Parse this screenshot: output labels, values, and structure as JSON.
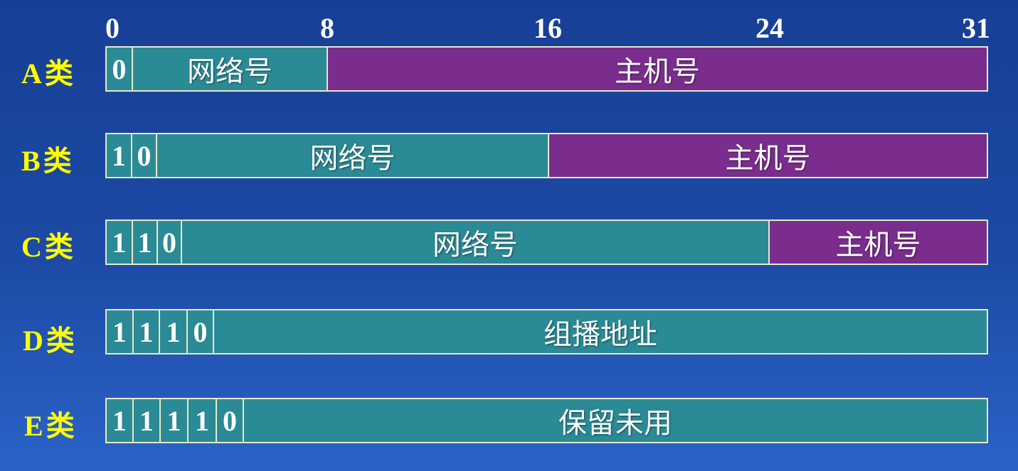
{
  "colors": {
    "network": "#2a8a96",
    "host": "#7a2d8c",
    "border": "#e8e8c8",
    "class_label": "#ffff00",
    "text": "#ffffff"
  },
  "ruler": [
    "0",
    "8",
    "16",
    "24",
    "31"
  ],
  "rows": [
    {
      "label": "A",
      "suffix": "类",
      "bits": [
        "0"
      ],
      "fields": [
        {
          "text": "网络号",
          "kind": "network"
        },
        {
          "text": "主机号",
          "kind": "host"
        }
      ]
    },
    {
      "label": "B",
      "suffix": "类",
      "bits": [
        "1",
        "0"
      ],
      "fields": [
        {
          "text": "网络号",
          "kind": "network"
        },
        {
          "text": "主机号",
          "kind": "host"
        }
      ]
    },
    {
      "label": "C",
      "suffix": "类",
      "bits": [
        "1",
        "1",
        "0"
      ],
      "fields": [
        {
          "text": "网络号",
          "kind": "network"
        },
        {
          "text": "主机号",
          "kind": "host"
        }
      ]
    },
    {
      "label": "D",
      "suffix": "类",
      "bits": [
        "1",
        "1",
        "1",
        "0"
      ],
      "fields": [
        {
          "text": "组播地址",
          "kind": "network"
        }
      ]
    },
    {
      "label": "E",
      "suffix": "类",
      "bits": [
        "1",
        "1",
        "1",
        "1",
        "0"
      ],
      "fields": [
        {
          "text": "保留未用",
          "kind": "network"
        }
      ]
    }
  ]
}
